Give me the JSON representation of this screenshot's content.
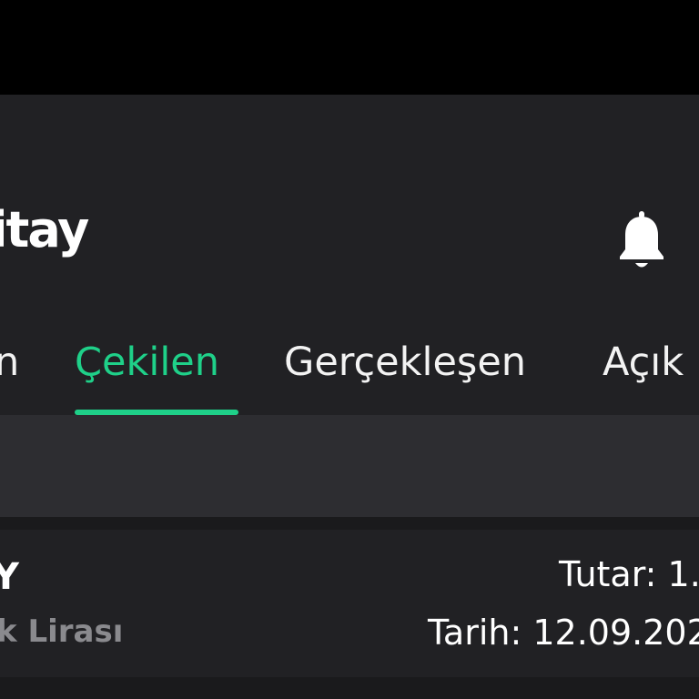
{
  "header": {
    "logo_text": "itay",
    "notifications_icon": "bell-icon"
  },
  "tabs": [
    {
      "label": "n",
      "active": false
    },
    {
      "label": "Çekilen",
      "active": true
    },
    {
      "label": "Gerçekleşen",
      "active": false
    },
    {
      "label": "Açık",
      "active": false
    }
  ],
  "orders": [
    {
      "symbol": "Y",
      "name": "k Lirası",
      "amount": "Tutar: 1.",
      "date": "Tarih: 12.09.202"
    }
  ],
  "colors": {
    "background": "#212124",
    "accent": "#1fd089",
    "filter_band": "#2d2d31",
    "muted_text": "#8a8a8e"
  }
}
